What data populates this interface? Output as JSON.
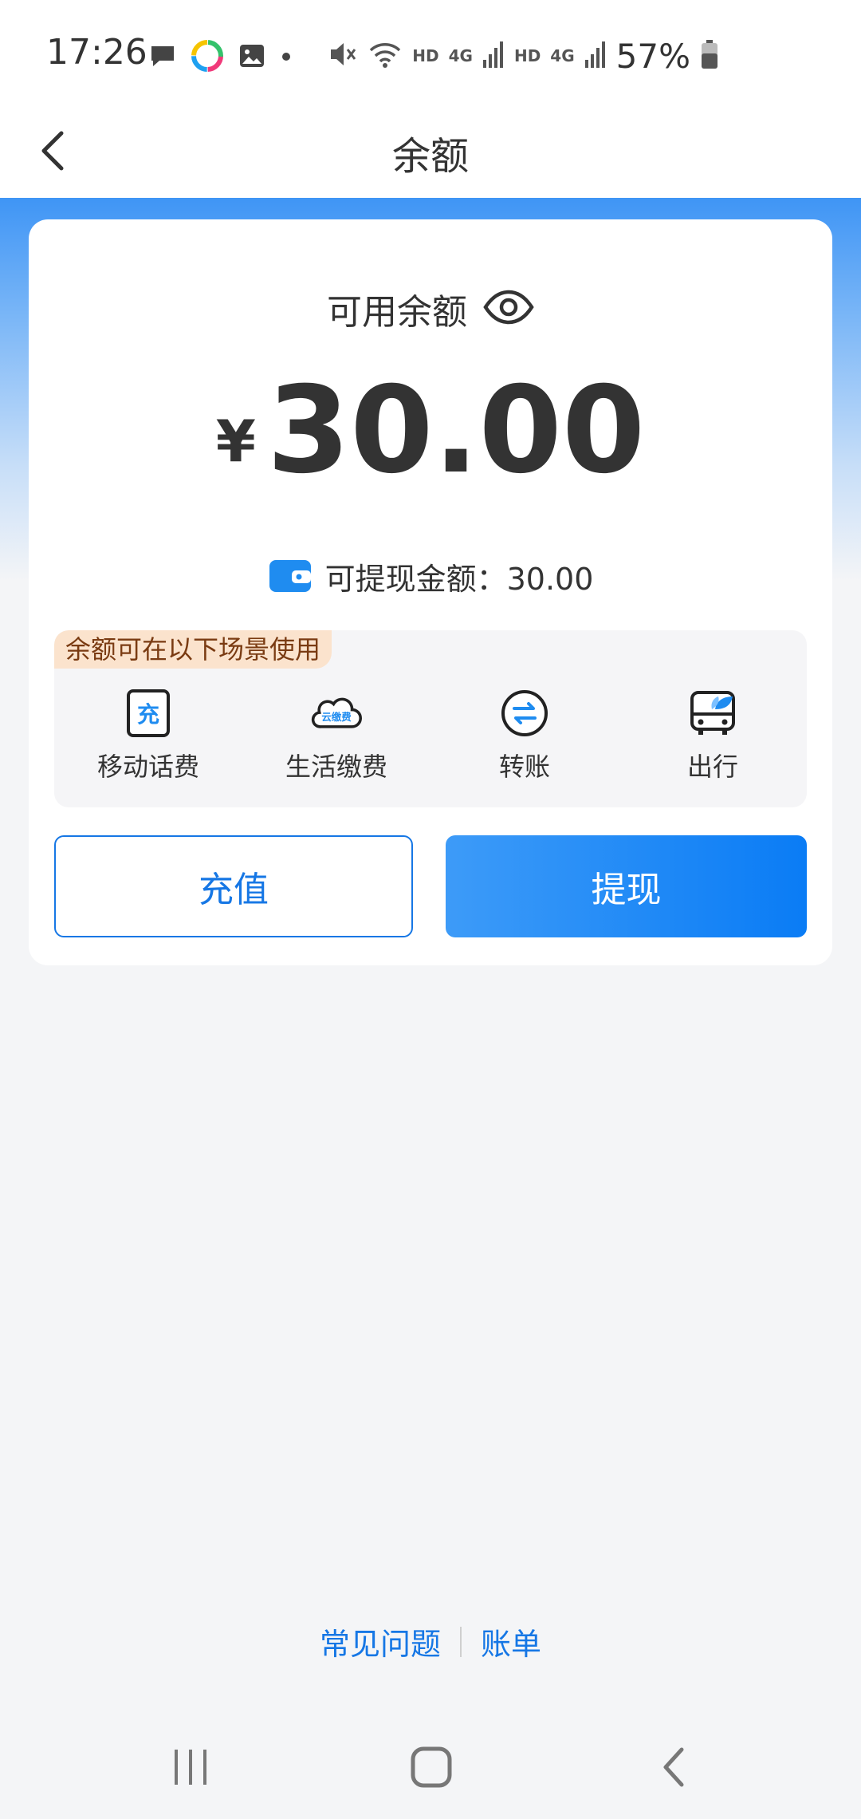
{
  "status_bar": {
    "time": "17:26",
    "hd1": "HD",
    "net1": "4G",
    "hd2": "HD",
    "net2": "4G",
    "battery": "57%"
  },
  "app_bar": {
    "title": "余额"
  },
  "balance": {
    "label": "可用余额",
    "currency": "¥",
    "amount": "30.00",
    "withdrawable_text": "可提现金额：30.00"
  },
  "scenes": {
    "tag": "余额可在以下场景使用",
    "items": [
      {
        "label": "移动话费",
        "icon": "phone-recharge-icon"
      },
      {
        "label": "生活缴费",
        "icon": "cloud-bill-icon"
      },
      {
        "label": "转账",
        "icon": "transfer-icon"
      },
      {
        "label": "出行",
        "icon": "bus-icon"
      }
    ],
    "recharge_icon_text": "充",
    "bill_icon_text": "云缴费"
  },
  "actions": {
    "recharge": "充值",
    "withdraw": "提现"
  },
  "footer": {
    "faq": "常见问题",
    "bill": "账单"
  },
  "colors": {
    "accent": "#1677e5",
    "tag_bg": "#fbe3cd",
    "tag_text": "#7a3b12"
  }
}
